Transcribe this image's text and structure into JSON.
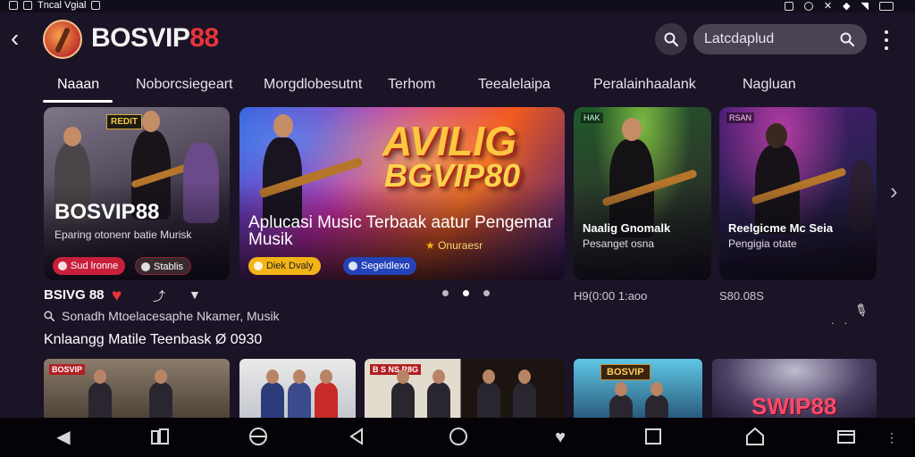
{
  "status_bar": {
    "left_text": "Tncal Vgial"
  },
  "header": {
    "brand_main": "BOSVIP",
    "brand_accent": "88",
    "search_placeholder": "Latcdaplud"
  },
  "tabs": [
    {
      "label": "Naaan",
      "active": true
    },
    {
      "label": "Noborcsiegeart",
      "active": false
    },
    {
      "label": "Morgdlobesutnt",
      "active": false
    },
    {
      "label": "Terhom",
      "active": false
    },
    {
      "label": "Teealelaipa",
      "active": false
    },
    {
      "label": "Peralainhaalank",
      "active": false
    },
    {
      "label": "Nagluan",
      "active": false
    }
  ],
  "cards": [
    {
      "badge": "REDIT",
      "title": "BOSVIP88",
      "subtitle": "Eparing otonenr batie Murisk",
      "pills": [
        {
          "label": "Sud lronne"
        },
        {
          "label": "Stablis"
        }
      ]
    },
    {
      "logo_line1": "AVILIG",
      "logo_line2": "BGVIP80",
      "title": "Aplucasi Music Terbaak aatur Pengemar Musik",
      "tag": "Onuraesr",
      "pills": [
        {
          "label": "Diek Dvaly"
        },
        {
          "label": "Segeldlexo"
        }
      ]
    },
    {
      "badge": "HAK",
      "title": "Naalig Gnomalk",
      "subtitle": "Pesanget osna"
    },
    {
      "badge": "RSAN",
      "title": "Reelgicme Mc Seia",
      "subtitle": "Pengigia otate"
    }
  ],
  "meta": {
    "title": "BSIVG 88",
    "card3_meta": "H9(0:00 1:aoo",
    "card4_meta": "S80.08S",
    "subtitle": "Sonadh Mtoelacesaphe Nkamer, Musik"
  },
  "carousel": {
    "dot_count": 3,
    "active_index": 1
  },
  "section": {
    "title": "Knlaangg Matile Teenbask Ø 0930"
  },
  "thumbnails": [
    {
      "sign": "BOSVIP"
    },
    {
      "sign": ""
    },
    {
      "sign": "B  S  NS  R8G"
    },
    {
      "sign": "BOSVIP"
    },
    {
      "sign": "SWIP88"
    }
  ],
  "icons": {
    "back": "back-arrow-icon",
    "search": "search-icon",
    "more": "more-vert-icon",
    "heart": "heart-icon",
    "share": "share-icon",
    "filter": "filter-icon",
    "pin": "pin-icon",
    "next": "chevron-right-icon"
  },
  "colors": {
    "background": "#1b1326",
    "brand_accent": "#e8343a",
    "pill_red": "#c8203a",
    "pill_yellow": "#f2b316",
    "pill_blue": "#2443b8"
  }
}
